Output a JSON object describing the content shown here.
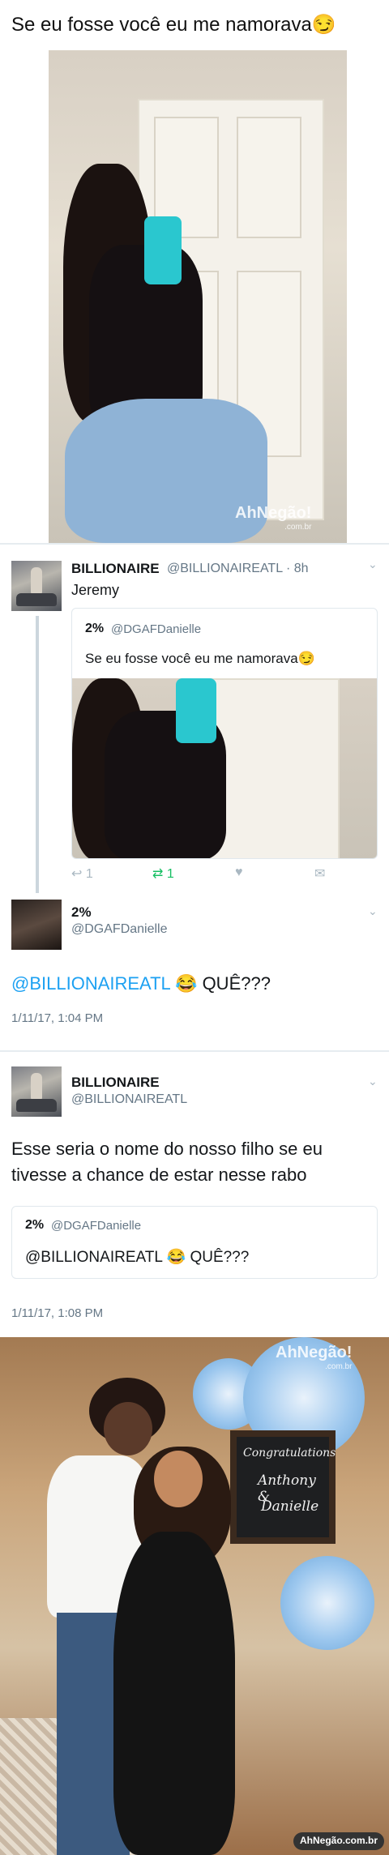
{
  "meme": {
    "caption": "Se eu fosse você eu me namorava😏",
    "watermark": "AhNegão!",
    "watermark_sub": ".com.br"
  },
  "tweet1": {
    "name": "BILLIONAIRE",
    "handle": "@BILLIONAIREATL · 8h",
    "text": "Jeremy",
    "quoted": {
      "name": "2%",
      "handle": "@DGAFDanielle",
      "text": "Se eu fosse você eu me namorava😏"
    },
    "actions": {
      "reply": "1",
      "retweet": "1",
      "like": "",
      "dm": ""
    }
  },
  "tweet2": {
    "name": "2%",
    "handle": "@DGAFDanielle",
    "mention": "@BILLIONAIREATL",
    "text_rest": " 😂 QUÊ???",
    "time": "1/11/17, 1:04 PM"
  },
  "tweet3": {
    "name": "BILLIONAIRE",
    "handle": "@BILLIONAIREATL",
    "text_line1": "Esse seria o nome do nosso filho se eu",
    "text_line2": "tivesse a chance de estar nesse rabo",
    "quoted": {
      "name": "2%",
      "handle": "@DGAFDanielle",
      "text": "@BILLIONAIREATL 😂 QUÊ???"
    },
    "time": "1/11/17, 1:08 PM"
  },
  "photo2": {
    "chalk_line1": "Congratulations",
    "chalk_line2": "Anthony &",
    "chalk_line3": "Danielle",
    "watermark": "AhNegão!",
    "watermark_sub": ".com.br",
    "corner_mark": "AhNegão.com.br"
  },
  "colors": {
    "link": "#1da1f2",
    "retweet": "#17bf63",
    "muted": "#657786"
  }
}
